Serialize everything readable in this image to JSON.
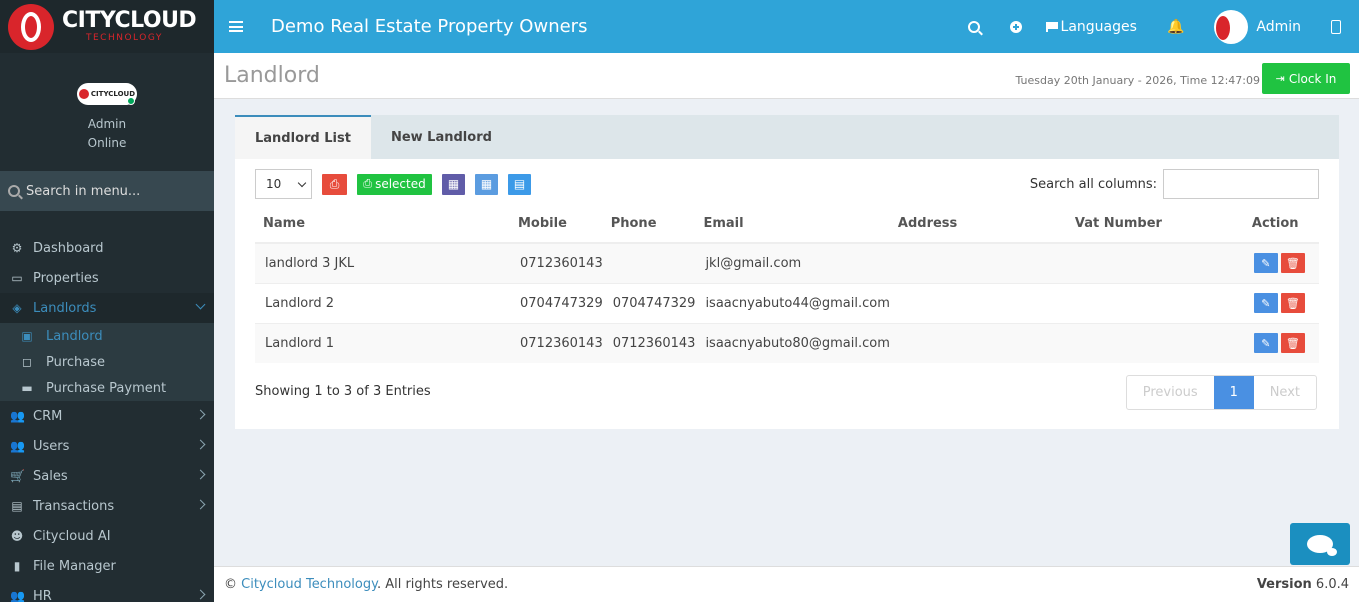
{
  "brand": {
    "logo_word": "CITYCLOUD",
    "logo_sub": "TECHNOLOGY"
  },
  "user_panel": {
    "logo_label": "CITYCLOUD",
    "name": "Admin",
    "status": "Online"
  },
  "sidebar_search": {
    "placeholder": "Search in menu..."
  },
  "menu": [
    {
      "label": "Dashboard",
      "icon": "dashboard-icon",
      "glyph": "⚙"
    },
    {
      "label": "Properties",
      "icon": "folder-open-icon",
      "glyph": "▭"
    },
    {
      "label": "Landlords",
      "icon": "layers-icon",
      "glyph": "◈"
    },
    {
      "label": "CRM",
      "icon": "users-icon",
      "glyph": "👥"
    },
    {
      "label": "Users",
      "icon": "users-icon",
      "glyph": "👥"
    },
    {
      "label": "Sales",
      "icon": "cart-icon",
      "glyph": "🛒"
    },
    {
      "label": "Transactions",
      "icon": "document-icon",
      "glyph": "▤"
    },
    {
      "label": "Citycloud AI",
      "icon": "robot-icon",
      "glyph": "☻"
    },
    {
      "label": "File Manager",
      "icon": "file-icon",
      "glyph": "▮"
    },
    {
      "label": "HR",
      "icon": "users-icon",
      "glyph": "👥"
    }
  ],
  "submenu": [
    {
      "label": "Landlord",
      "icon": "briefcase-icon",
      "glyph": "▣"
    },
    {
      "label": "Purchase",
      "icon": "shopping-bag-icon",
      "glyph": "◻"
    },
    {
      "label": "Purchase Payment",
      "icon": "money-icon",
      "glyph": "▬"
    }
  ],
  "topbar": {
    "title": "Demo Real Estate Property Owners",
    "languages": "Languages",
    "admin": "Admin"
  },
  "header": {
    "page_title": "Landlord",
    "datetime": "Tuesday 20th January - 2026,  Time  12:47:09",
    "clock_in": "Clock In"
  },
  "tabs": [
    "Landlord List",
    "New Landlord"
  ],
  "toolbar": {
    "page_size": "10",
    "selected_label": "selected",
    "search_label": "Search all columns:"
  },
  "table": {
    "columns": [
      "Name",
      "Mobile",
      "Phone",
      "Email",
      "Address",
      "Vat Number",
      "Action"
    ],
    "rows": [
      {
        "name": "landlord 3 JKL",
        "mobile": "0712360143",
        "phone": "",
        "email": "jkl@gmail.com",
        "address": "",
        "vat": ""
      },
      {
        "name": "Landlord 2",
        "mobile": "0704747329",
        "phone": "0704747329",
        "email": "isaacnyabuto44@gmail.com",
        "address": "",
        "vat": ""
      },
      {
        "name": "Landlord 1",
        "mobile": "0712360143",
        "phone": "0712360143",
        "email": "isaacnyabuto80@gmail.com",
        "address": "",
        "vat": ""
      }
    ]
  },
  "pagination": {
    "showing": "Showing 1 to 3 of 3 Entries",
    "previous": "Previous",
    "current": "1",
    "next": "Next"
  },
  "footer": {
    "copyright_prefix": "©",
    "brand": "Citycloud Technology",
    "rights": ". All rights reserved.",
    "version_label": "Version",
    "version": "6.0.4"
  },
  "colors": {
    "topbar": "#2fa4d8",
    "sidebar": "#222d32",
    "accent": "#3c8dbc",
    "success": "#20c341",
    "danger": "#e74c3c"
  }
}
